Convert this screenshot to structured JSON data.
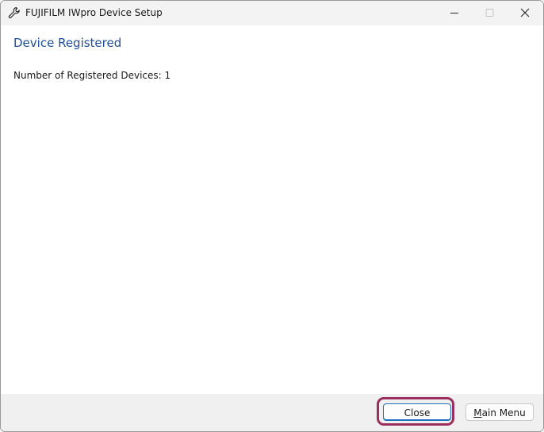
{
  "window": {
    "title": "FUJIFILM IWpro Device Setup",
    "icon": "wrench-icon",
    "controls": {
      "minimize": "minimize-icon",
      "maximize": "maximize-icon",
      "close": "close-icon"
    }
  },
  "main": {
    "heading": "Device Registered",
    "device_count_text": "Number of Registered Devices: 1"
  },
  "footer": {
    "close_label": "Close",
    "main_menu_mnemonic": "M",
    "main_menu_rest": "ain Menu"
  },
  "colors": {
    "heading": "#1f4e9a",
    "highlight": "#9b2e5c",
    "focus_border": "#1c6fc2"
  }
}
